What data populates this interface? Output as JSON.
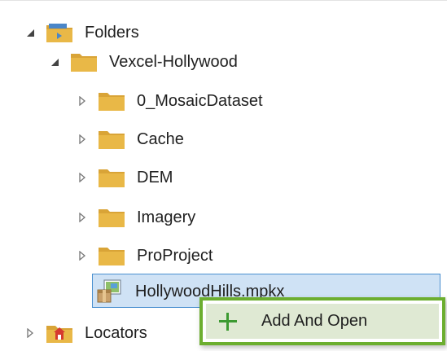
{
  "tree": {
    "folders_label": "Folders",
    "root_folder_label": "Vexcel-Hollywood",
    "children": [
      {
        "label": "0_MosaicDataset"
      },
      {
        "label": "Cache"
      },
      {
        "label": "DEM"
      },
      {
        "label": "Imagery"
      },
      {
        "label": "ProProject"
      }
    ],
    "map_package_label": "HollywoodHills.mpkx",
    "locators_label": "Locators"
  },
  "context_menu": {
    "add_and_open_label": "Add And Open"
  },
  "colors": {
    "folder": "#e9b847",
    "selection": "#cfe2f5",
    "menu_border": "#6cae2f",
    "menu_hover": "#dfe9d3",
    "plus": "#3c9a31"
  }
}
